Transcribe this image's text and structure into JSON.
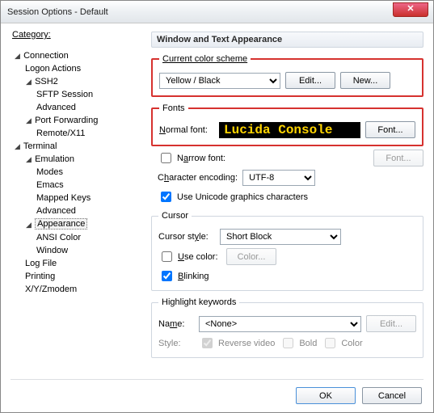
{
  "window": {
    "title": "Session Options - Default"
  },
  "category_label": "Category:",
  "tree": {
    "connection": "Connection",
    "logon_actions": "Logon Actions",
    "ssh2": "SSH2",
    "sftp_session": "SFTP Session",
    "advanced": "Advanced",
    "port_forwarding": "Port Forwarding",
    "remote_x11": "Remote/X11",
    "terminal": "Terminal",
    "emulation": "Emulation",
    "modes": "Modes",
    "emacs": "Emacs",
    "mapped_keys": "Mapped Keys",
    "advanced2": "Advanced",
    "appearance": "Appearance",
    "ansi_color": "ANSI Color",
    "window": "Window",
    "log_file": "Log File",
    "printing": "Printing",
    "xyzmodem": "X/Y/Zmodem"
  },
  "panel": {
    "header": "Window and Text Appearance",
    "color_scheme": {
      "legend": "Current color scheme",
      "value": "Yellow / Black",
      "edit": "Edit...",
      "new": "New..."
    },
    "fonts": {
      "legend": "Fonts",
      "normal_label": "Normal font:",
      "preview": "Lucida Console",
      "font_btn": "Font...",
      "narrow_label": "Narrow font:",
      "narrow_checked": false,
      "font_btn2": "Font...",
      "enc_label": "Character encoding:",
      "enc_value": "UTF-8",
      "unicode_label": "Use Unicode graphics characters",
      "unicode_checked": true
    },
    "cursor": {
      "legend": "Cursor",
      "style_label": "Cursor style:",
      "style_value": "Short Block",
      "use_color_label": "Use color:",
      "use_color_checked": false,
      "color_btn": "Color...",
      "blinking_label": "Blinking",
      "blinking_checked": true
    },
    "highlight": {
      "legend": "Highlight keywords",
      "name_label": "Name:",
      "name_value": "<None>",
      "edit_btn": "Edit...",
      "style_label": "Style:",
      "reverse_label": "Reverse video",
      "reverse_checked": true,
      "bold_label": "Bold",
      "bold_checked": false,
      "color_label": "Color",
      "color_checked": false
    }
  },
  "footer": {
    "ok": "OK",
    "cancel": "Cancel"
  }
}
